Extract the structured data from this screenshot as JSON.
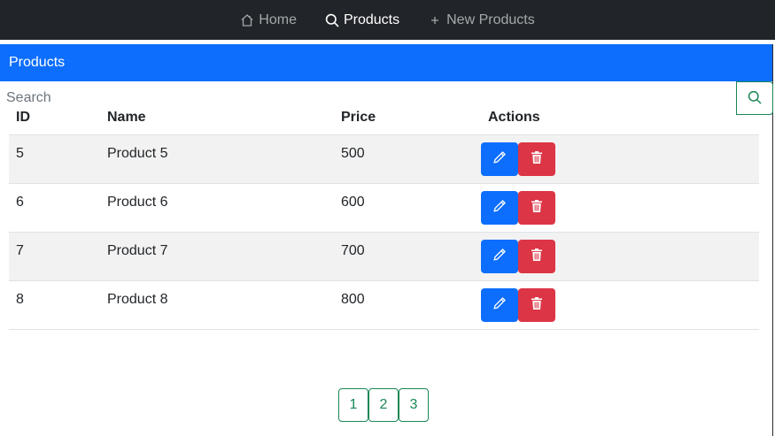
{
  "nav": {
    "items": [
      {
        "label": "Home",
        "icon": "house-icon",
        "active": false
      },
      {
        "label": "Products",
        "icon": "search-icon",
        "active": true
      },
      {
        "label": "New Products",
        "icon": "plus-icon",
        "active": false
      }
    ]
  },
  "card": {
    "title": "Products"
  },
  "search": {
    "placeholder": "Search",
    "value": ""
  },
  "table": {
    "headers": [
      "ID",
      "Name",
      "Price",
      "Actions"
    ],
    "rows": [
      {
        "id": "5",
        "name": "Product 5",
        "price": "500"
      },
      {
        "id": "6",
        "name": "Product 6",
        "price": "600"
      },
      {
        "id": "7",
        "name": "Product 7",
        "price": "700"
      },
      {
        "id": "8",
        "name": "Product 8",
        "price": "800"
      }
    ]
  },
  "pagination": {
    "pages": [
      "1",
      "2",
      "3"
    ]
  },
  "colors": {
    "navbar": "#212529",
    "primary": "#0d6efd",
    "danger": "#dc3545",
    "success": "#198754"
  }
}
